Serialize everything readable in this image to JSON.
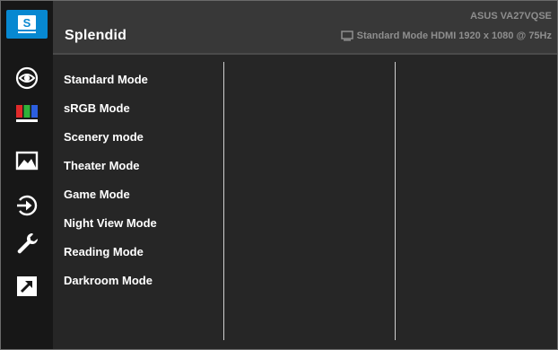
{
  "header": {
    "title": "Splendid",
    "model": "ASUS  VA27VQSE",
    "status": "Standard Mode HDMI 1920 x 1080 @ 75Hz"
  },
  "sidebar": {
    "splendid_label": "S",
    "icons": [
      "splendid-icon",
      "eye-care-icon",
      "color-icon",
      "image-icon",
      "input-select-icon",
      "system-setup-icon",
      "shortcut-icon"
    ],
    "accent": "#0788d1"
  },
  "menu": {
    "items": [
      "Standard Mode",
      "sRGB Mode",
      "Scenery mode",
      "Theater Mode",
      "Game Mode",
      "Night View Mode",
      "Reading Mode",
      "Darkroom Mode"
    ]
  }
}
